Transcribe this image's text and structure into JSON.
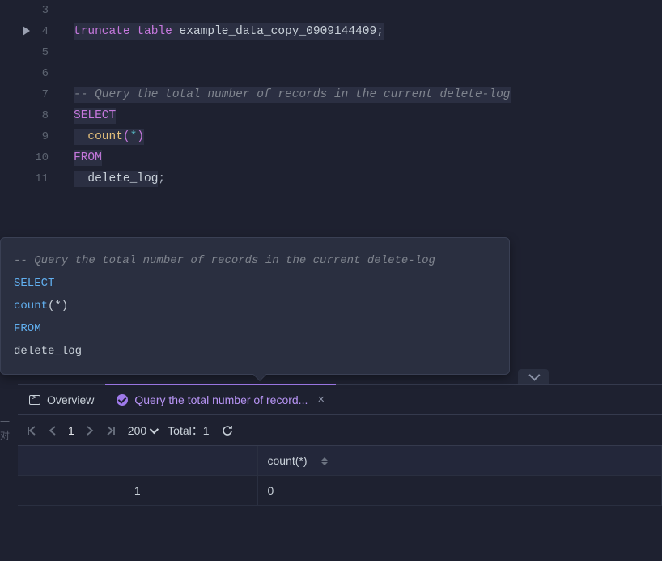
{
  "editor": {
    "lines": [
      {
        "n": "3",
        "tokens": []
      },
      {
        "n": "4",
        "run": true,
        "tokens": [
          {
            "c": "hl-kw",
            "t": "truncate",
            "hl": true
          },
          {
            "c": "hl-id",
            "t": " ",
            "hl": true
          },
          {
            "c": "hl-kw2",
            "t": "table",
            "hl": true
          },
          {
            "c": "hl-id",
            "t": " example_data_copy_0909144409",
            "hl": true
          },
          {
            "c": "hl-punct",
            "t": ";",
            "hl": true
          }
        ]
      },
      {
        "n": "5",
        "tokens": [
          {
            "c": "hl-id",
            "t": "",
            "hl": true
          }
        ]
      },
      {
        "n": "6",
        "tokens": [
          {
            "c": "hl-id",
            "t": "",
            "hl": true
          }
        ]
      },
      {
        "n": "7",
        "tokens": [
          {
            "c": "hl-comment",
            "t": "-- Query the total number of records in the current delete-log",
            "hl": true
          }
        ]
      },
      {
        "n": "8",
        "tokens": [
          {
            "c": "hl-kw",
            "t": "SELECT",
            "hl": true
          }
        ]
      },
      {
        "n": "9",
        "tokens": [
          {
            "c": "hl-id",
            "t": "  ",
            "hl": true
          },
          {
            "c": "hl-func",
            "t": "count",
            "hl": true
          },
          {
            "c": "hl-paren",
            "t": "(",
            "hl": true
          },
          {
            "c": "hl-star",
            "t": "*",
            "hl": true
          },
          {
            "c": "hl-paren",
            "t": ")",
            "hl": true
          }
        ]
      },
      {
        "n": "10",
        "tokens": [
          {
            "c": "hl-kw",
            "t": "FROM",
            "hl": true
          }
        ]
      },
      {
        "n": "11",
        "tokens": [
          {
            "c": "hl-id",
            "t": "  delete_log",
            "hl": true
          },
          {
            "c": "hl-punct",
            "t": ";"
          }
        ]
      }
    ]
  },
  "tooltip": {
    "lines": [
      [
        {
          "c": "tt-comment",
          "t": "-- Query the total number of records in the current delete-log"
        }
      ],
      [
        {
          "c": "tt-kw",
          "t": "SELECT"
        }
      ],
      [
        {
          "c": "tt-plain",
          "t": "  "
        },
        {
          "c": "tt-func",
          "t": "count"
        },
        {
          "c": "tt-plain",
          "t": "(*)"
        }
      ],
      [
        {
          "c": "tt-kw",
          "t": "FROM"
        }
      ],
      [
        {
          "c": "tt-plain",
          "t": "  delete_log"
        }
      ]
    ]
  },
  "tabs": {
    "overview": "Overview",
    "query": "Query the total number of record..."
  },
  "toolbar": {
    "page": "1",
    "page_size": "200",
    "total_label": "Total：",
    "total_value": "1"
  },
  "table": {
    "header": "count(*)",
    "rows": [
      {
        "n": "1",
        "v": "0"
      }
    ]
  },
  "left_edge": "一对"
}
